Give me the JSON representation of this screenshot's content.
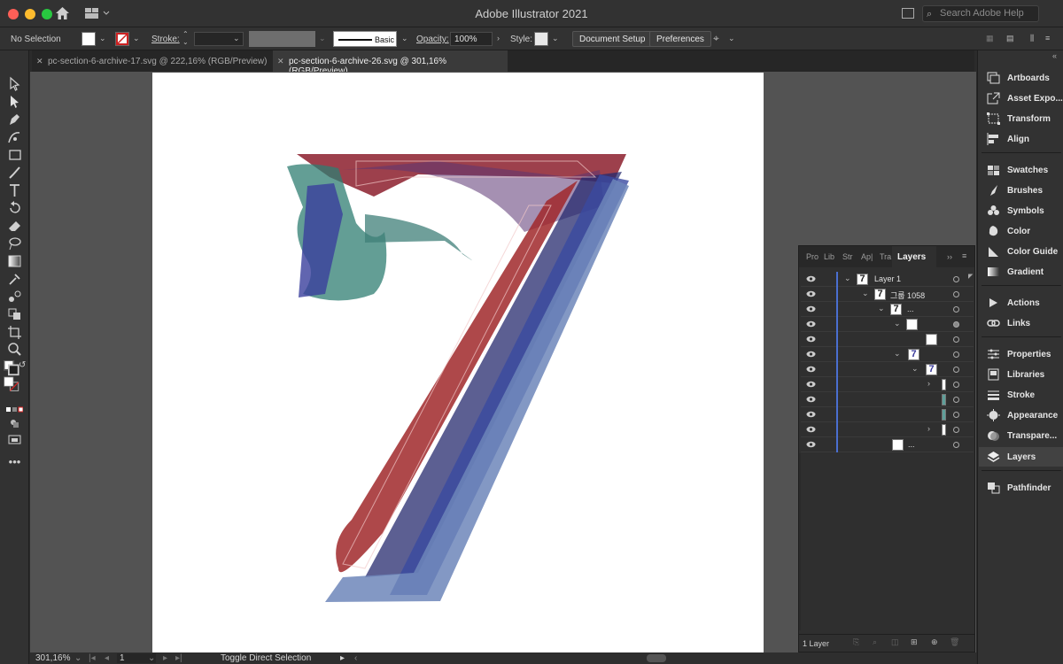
{
  "window": {
    "app_title": "Adobe Illustrator 2021",
    "help_search_placeholder": "Search Adobe Help"
  },
  "control_bar": {
    "selection_label": "No Selection",
    "stroke_label": "Stroke:",
    "brush_profile": "Basic",
    "opacity_label": "Opacity:",
    "opacity_value": "100%",
    "style_label": "Style:",
    "document_setup": "Document Setup",
    "preferences": "Preferences"
  },
  "tabs": [
    {
      "label": "pc-section-6-archive-17.svg @ 222,16% (RGB/Preview)",
      "active": false
    },
    {
      "label": "pc-section-6-archive-26.svg @ 301,16% (RGB/Preview)",
      "active": true
    }
  ],
  "status_bar": {
    "zoom": "301,16%",
    "artboard": "1",
    "status_text": "Toggle Direct Selection"
  },
  "right_dock": {
    "items": [
      {
        "label": "Artboards",
        "icon": "artboards-icon"
      },
      {
        "label": "Asset Expo...",
        "icon": "asset-export-icon"
      },
      {
        "label": "Transform",
        "icon": "transform-icon"
      },
      {
        "label": "Align",
        "icon": "align-icon"
      },
      {
        "label": "Swatches",
        "icon": "swatches-icon"
      },
      {
        "label": "Brushes",
        "icon": "brushes-icon"
      },
      {
        "label": "Symbols",
        "icon": "symbols-icon"
      },
      {
        "label": "Color",
        "icon": "color-icon"
      },
      {
        "label": "Color Guide",
        "icon": "color-guide-icon"
      },
      {
        "label": "Gradient",
        "icon": "gradient-icon"
      },
      {
        "label": "Actions",
        "icon": "actions-icon"
      },
      {
        "label": "Links",
        "icon": "links-icon"
      },
      {
        "label": "Properties",
        "icon": "properties-icon"
      },
      {
        "label": "Libraries",
        "icon": "libraries-icon"
      },
      {
        "label": "Stroke",
        "icon": "stroke-icon"
      },
      {
        "label": "Appearance",
        "icon": "appearance-icon"
      },
      {
        "label": "Transpare...",
        "icon": "transparency-icon"
      },
      {
        "label": "Layers",
        "icon": "layers-icon"
      },
      {
        "label": "Pathfinder",
        "icon": "pathfinder-icon"
      }
    ]
  },
  "layers_panel": {
    "tabs": [
      "Pro",
      "Lib",
      "Str",
      "Ap|",
      "Tra",
      "Layers"
    ],
    "rows": [
      {
        "name": "Layer 1",
        "thumb": "7"
      },
      {
        "name": "그룹 1058",
        "thumb": "7"
      },
      {
        "name": "...",
        "thumb": "7"
      },
      {
        "name": "",
        "thumb": ""
      },
      {
        "name": "",
        "thumb": ""
      },
      {
        "name": "",
        "thumb": "7"
      },
      {
        "name": "",
        "thumb": "7"
      },
      {
        "name": "",
        "thumb": ""
      },
      {
        "name": "",
        "thumb": ""
      },
      {
        "name": "",
        "thumb": ""
      },
      {
        "name": "",
        "thumb": ""
      },
      {
        "name": "...",
        "thumb": ""
      }
    ],
    "footer": "1 Layer"
  },
  "colors": {
    "accent_blue": "#4a6fd0",
    "red_shape": "#a0282a",
    "blue_shape": "#3a4aa0",
    "teal_shape": "#3f7f78"
  }
}
